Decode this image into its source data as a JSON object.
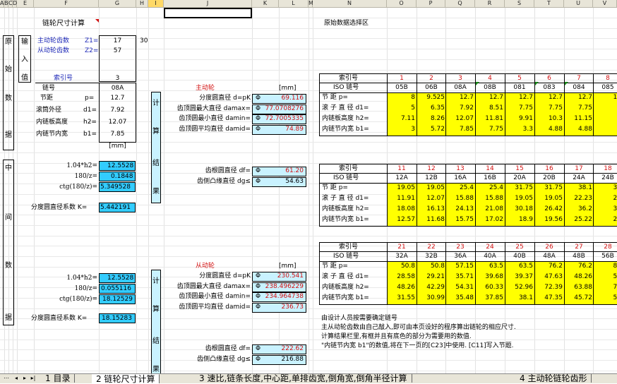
{
  "col_headers": [
    "A",
    "B",
    "C",
    "D",
    "E",
    "F",
    "G",
    "H",
    "I",
    "J",
    "K",
    "L",
    "M",
    "N",
    "O",
    "P",
    "Q",
    "R",
    "S",
    "T",
    "U",
    "V"
  ],
  "left": {
    "title": "链轮尺寸计算",
    "side_labels": [
      "原",
      "始",
      "数",
      "据",
      "中",
      "间",
      "数",
      "据"
    ],
    "input_label": [
      "输",
      "入",
      "值"
    ],
    "z1_label": "主动轮齿数",
    "z1_sym": "Z1=",
    "z1_val": "17",
    "g_val": "30",
    "z2_label": "从动轮齿数",
    "z2_sym": "Z2=",
    "z2_val": "57",
    "index_label": "索引号",
    "index_val": "3",
    "chain_label": "链号",
    "chain_val": "08A",
    "p_label": "节距",
    "p_sym": "p=",
    "p_val": "12.7",
    "d1_label": "滚筒外径",
    "d1_sym": "d1=",
    "d1_val": "7.92",
    "h2_label": "内链板高度",
    "h2_sym": "h2=",
    "h2_val": "12.07",
    "b1_label": "内链节内宽",
    "b1_sym": "b1=",
    "b1_val": "7.85",
    "unit_mm": "[mm]",
    "mid1": {
      "a_label": "1.04*h2=",
      "a_val": "12.5528",
      "b_label": "180/z=",
      "b_val": "0.1848",
      "c_label": "ctg(180/z)=",
      "c_val": "5.349528",
      "k_label": "分度圆直径系数 K=",
      "k_val": "5.442191"
    },
    "mid2": {
      "a_label": "1.04*h2=",
      "a_val": "12.5528",
      "b_label": "180/z=",
      "b_val": "0.055116",
      "c_label": "ctg(180/z)=",
      "c_val": "18.12529",
      "k_label": "分度圆直径系数 K=",
      "k_val": "18.15283"
    }
  },
  "calc": {
    "side1": [
      "计",
      "算",
      "结",
      "果"
    ],
    "side2": [
      "计",
      "算",
      "结",
      "果"
    ],
    "driver_title": "主动轮",
    "driven_title": "从动轮",
    "unit": "[mm]",
    "phi": "Φ",
    "rows1": [
      {
        "label": "分度圆直径 d=pK",
        "val": "69.116"
      },
      {
        "label": "齿顶圆最大直径 damax=",
        "val": "77.0708276"
      },
      {
        "label": "齿顶圆最小直径 damin=",
        "val": "72.7005335"
      },
      {
        "label": "齿顶圆平均直径 damid=",
        "val": "74.89"
      }
    ],
    "rows1b": [
      {
        "label": "齿根圆直径 df=",
        "val": "61.20"
      },
      {
        "label": "齿侧凸缘直径 dg≤",
        "val": "54.63"
      }
    ],
    "rows2": [
      {
        "label": "分度圆直径 d=pK",
        "val": "230.541"
      },
      {
        "label": "齿顶圆最大直径 damax=",
        "val": "238.496229"
      },
      {
        "label": "齿顶圆最小直径 damin=",
        "val": "234.964738"
      },
      {
        "label": "齿顶圆平均直径 damid=",
        "val": "236.73"
      }
    ],
    "rows2b": [
      {
        "label": "齿根圆直径 df=",
        "val": "222.62"
      },
      {
        "label": "齿侧凸缘直径 dg≤",
        "val": "216.88"
      }
    ]
  },
  "right": {
    "title": "原始数据选择区",
    "row_labels": [
      "索引号",
      "ISO 链号",
      "节 距 p=",
      "滚 子 直 径 d1=",
      "内链板高度 h2=",
      "内链节内宽 b1="
    ],
    "t1": {
      "idx": [
        "1",
        "2",
        "3",
        "4",
        "5",
        "6",
        "7",
        "8"
      ],
      "iso": [
        "05B",
        "06B",
        "08A",
        "08B",
        "081",
        "083",
        "084",
        "085"
      ],
      "p": [
        "8",
        "9.525",
        "12.7",
        "12.7",
        "12.7",
        "12.7",
        "12.7",
        "12"
      ],
      "d1": [
        "5",
        "6.35",
        "7.92",
        "8.51",
        "7.75",
        "7.75",
        "7.75",
        "7"
      ],
      "h2": [
        "7.11",
        "8.26",
        "12.07",
        "11.81",
        "9.91",
        "10.3",
        "11.15",
        "9"
      ],
      "b1": [
        "3",
        "5.72",
        "7.85",
        "7.75",
        "3.3",
        "4.88",
        "4.88",
        "6"
      ]
    },
    "t2": {
      "idx": [
        "11",
        "12",
        "13",
        "14",
        "15",
        "16",
        "17",
        "18"
      ],
      "iso": [
        "12A",
        "12B",
        "16A",
        "16B",
        "20A",
        "20B",
        "24A",
        "24B"
      ],
      "p": [
        "19.05",
        "19.05",
        "25.4",
        "25.4",
        "31.75",
        "31.75",
        "38.1",
        "38"
      ],
      "d1": [
        "11.91",
        "12.07",
        "15.88",
        "15.88",
        "19.05",
        "19.05",
        "22.23",
        "25"
      ],
      "h2": [
        "18.08",
        "16.13",
        "24.13",
        "21.08",
        "30.18",
        "26.42",
        "36.2",
        "33"
      ],
      "b1": [
        "12.57",
        "11.68",
        "15.75",
        "17.02",
        "18.9",
        "19.56",
        "25.22",
        "25"
      ]
    },
    "t3": {
      "idx": [
        "21",
        "22",
        "23",
        "24",
        "25",
        "26",
        "27",
        "28"
      ],
      "iso": [
        "32A",
        "32B",
        "36A",
        "40A",
        "40B",
        "48A",
        "48B",
        "56B"
      ],
      "p": [
        "50.8",
        "50.8",
        "57.15",
        "63.5",
        "63.5",
        "76.2",
        "76.2",
        "88"
      ],
      "d1": [
        "28.58",
        "29.21",
        "35.71",
        "39.68",
        "39.37",
        "47.63",
        "48.26",
        "53"
      ],
      "h2": [
        "48.26",
        "42.29",
        "54.31",
        "60.33",
        "52.96",
        "72.39",
        "63.88",
        "77"
      ],
      "b1": [
        "31.55",
        "30.99",
        "35.48",
        "37.85",
        "38.1",
        "47.35",
        "45.72",
        "53"
      ]
    },
    "notes": [
      "由设计人员按需要确定链号",
      "主从动轮齿数由自己敲入,即可由本页设好的程序算出链轮的相应尺寸.",
      "计算结果栏里,有框并且有底色的部分为需要用的数值.",
      "\"内链节内宽 b1\"的数值,将在下一页的[C23]中使用. [C11]写入节题."
    ]
  },
  "tabs": [
    "1 目录",
    "2 链轮尺寸计算",
    "3 速比,链条长度,中心距,单排齿宽,倒角宽,倒角半径计算",
    "4 主动轮链轮齿形"
  ]
}
